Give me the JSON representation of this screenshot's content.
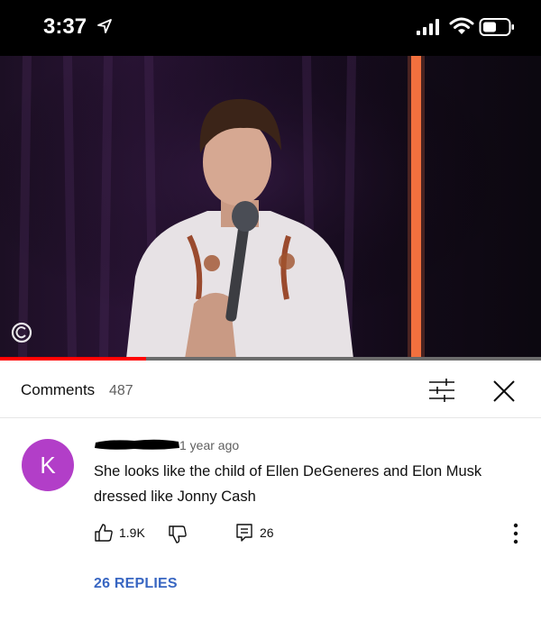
{
  "status_bar": {
    "time": "3:37",
    "icons": [
      "location-arrow-icon",
      "signal-icon",
      "wifi-icon",
      "battery-icon"
    ]
  },
  "video": {
    "watermark_icon": "comedy-central-logo-icon",
    "progress_fraction": 0.27,
    "progress_color": "#ff0000"
  },
  "comments_panel": {
    "title": "Comments",
    "count": "487",
    "icons": [
      "filter-sliders-icon",
      "close-icon"
    ]
  },
  "comment": {
    "avatar_letter": "K",
    "avatar_color": "#b23ec8",
    "timestamp": "1 year ago",
    "text": "She looks like the child of Ellen DeGeneres and Elon Musk dressed like Jonny Cash",
    "likes": "1.9K",
    "reply_count": "26",
    "replies_link": "26 REPLIES",
    "link_color": "#3866c2"
  }
}
